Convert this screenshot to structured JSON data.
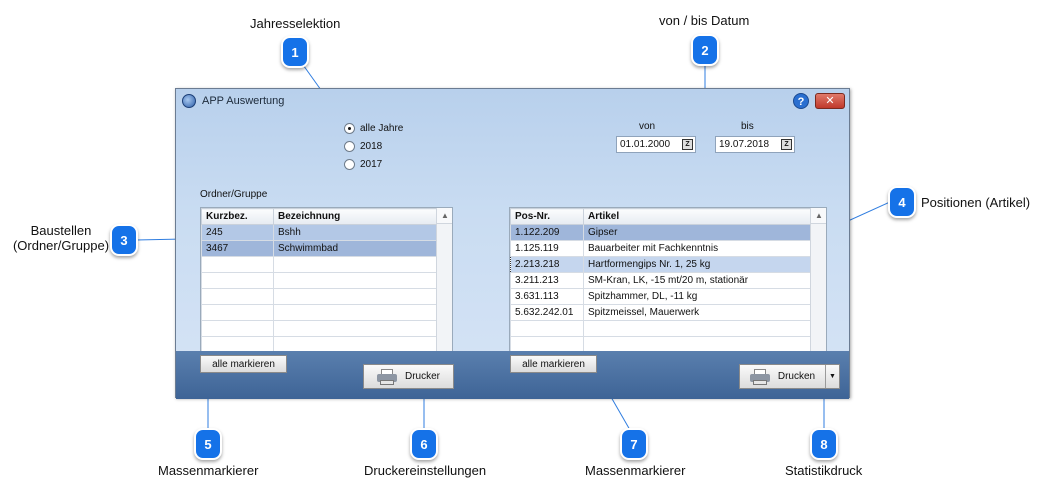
{
  "callouts": [
    {
      "number": "1",
      "label": "Jahresselektion"
    },
    {
      "number": "2",
      "label": "von / bis Datum"
    },
    {
      "number": "3",
      "label_line1": "Baustellen",
      "label_line2": "(Ordner/Gruppe)"
    },
    {
      "number": "4",
      "label": "Positionen (Artikel)"
    },
    {
      "number": "5",
      "label": "Massenmarkierer"
    },
    {
      "number": "6",
      "label": "Druckereinstellungen"
    },
    {
      "number": "7",
      "label": "Massenmarkierer"
    },
    {
      "number": "8",
      "label": "Statistikdruck"
    }
  ],
  "window": {
    "title": "APP Auswertung",
    "help_glyph": "?",
    "close_glyph": "✕"
  },
  "year_selection": {
    "options": [
      {
        "label": "alle Jahre",
        "checked": true
      },
      {
        "label": "2018",
        "checked": false
      },
      {
        "label": "2017",
        "checked": false
      }
    ]
  },
  "dates": {
    "from_label": "von",
    "from_value": "01.01.2000",
    "to_label": "bis",
    "to_value": "19.07.2018",
    "calendar_glyph": "Z"
  },
  "groups": {
    "label": "Ordner/Gruppe",
    "columns": [
      "Kurzbez.",
      "Bezeichnung"
    ],
    "rows": [
      [
        "245",
        "Bshh"
      ],
      [
        "3467",
        "Schwimmbad"
      ],
      [
        "",
        ""
      ],
      [
        "",
        ""
      ],
      [
        "",
        ""
      ],
      [
        "",
        ""
      ],
      [
        "",
        ""
      ],
      [
        "",
        ""
      ]
    ]
  },
  "positions": {
    "columns": [
      "Pos-Nr.",
      "Artikel"
    ],
    "rows": [
      [
        "1.122.209",
        "Gipser"
      ],
      [
        "1.125.119",
        "Bauarbeiter mit Fachkenntnis"
      ],
      [
        "2.213.218",
        "Hartformengips Nr. 1, 25 kg"
      ],
      [
        "3.211.213",
        "SM-Kran, LK, -15 mt/20 m, stationär"
      ],
      [
        "3.631.113",
        "Spitzhammer, DL, -11 kg"
      ],
      [
        "5.632.242.01",
        "Spitzmeissel, Mauerwerk"
      ],
      [
        "",
        ""
      ],
      [
        "",
        ""
      ]
    ]
  },
  "buttons": {
    "mark_all_left": "alle markieren",
    "printer": "Drucker",
    "mark_all_right": "alle markieren",
    "print": "Drucken",
    "print_dropdown_glyph": "▼"
  },
  "colors": {
    "callout_blue": "#1572e8",
    "callout_line": "#2f7de0",
    "bottom_bar": "#4a6fa0"
  }
}
